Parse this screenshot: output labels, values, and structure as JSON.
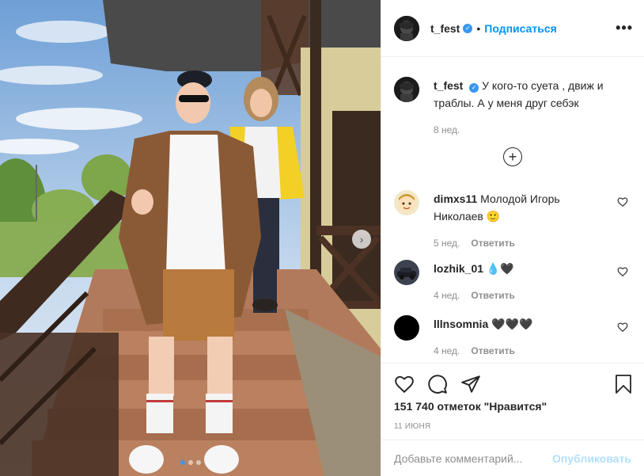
{
  "post": {
    "username": "t_fest",
    "verified_mark": "✓",
    "separator": "•",
    "follow_label": "Подписаться",
    "more_label": "•••"
  },
  "caption": {
    "username": "t_fest",
    "text": "У кого-то суета , движ и траблы. А у меня друг себэк",
    "time": "8 нед."
  },
  "load_more_label": "+",
  "comments": [
    {
      "username": "dimxs11",
      "text": "Молодой Игорь Николаев 🙂",
      "time": "5 нед.",
      "reply": "Ответить"
    },
    {
      "username": "lozhik_01",
      "text": "💧🖤",
      "time": "4 нед.",
      "reply": "Ответить"
    },
    {
      "username": "lllnsomnia",
      "text": "🖤🖤🖤",
      "time": "4 нед.",
      "reply": "Ответить"
    }
  ],
  "likes_text": "151 740 отметок \"Нравится\"",
  "date": "11 июня",
  "add_comment": {
    "placeholder": "Добавьте комментарий...",
    "publish_label": "Опубликовать"
  },
  "carousel": {
    "current": 1,
    "total": 3,
    "next_label": "›"
  },
  "colors": {
    "accent": "#0095f6",
    "text": "#262626",
    "muted": "#8e8e8e",
    "publish_disabled": "#b2dffc"
  }
}
